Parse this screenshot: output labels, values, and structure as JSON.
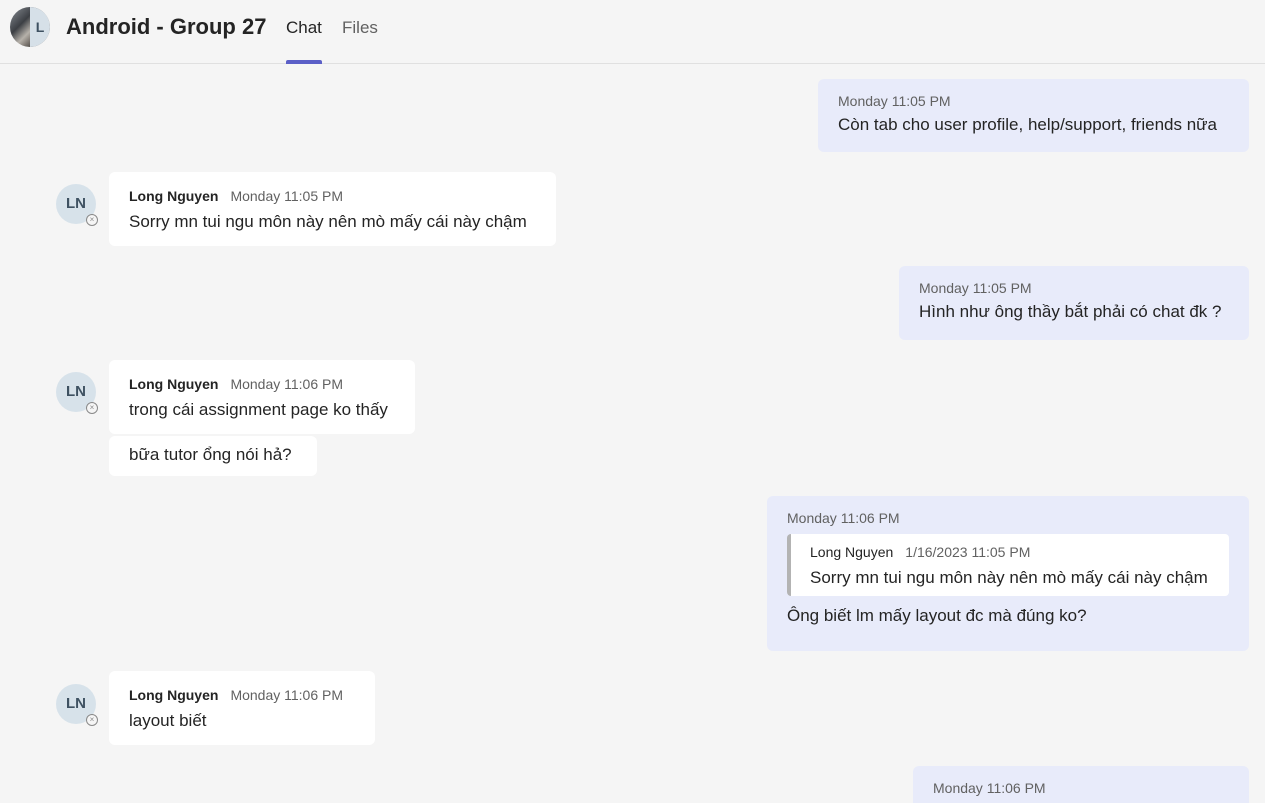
{
  "header": {
    "avatar_letter": "L",
    "title": "Android - Group 27",
    "tabs": [
      {
        "label": "Chat",
        "active": true
      },
      {
        "label": "Files",
        "active": false
      }
    ],
    "accent_color": "#5b5fc7"
  },
  "messages": [
    {
      "mine": true,
      "time": "Monday 11:05 PM",
      "text": "Còn tab cho user profile, help/support, friends nữa"
    },
    {
      "mine": false,
      "sender": "Long Nguyen",
      "initials": "LN",
      "time": "Monday 11:05 PM",
      "text": "Sorry mn tui ngu môn này nên mò mấy cái này chậm"
    },
    {
      "mine": true,
      "time": "Monday 11:05 PM",
      "text": "Hình như ông thầy bắt phải có chat đk ?"
    },
    {
      "mine": false,
      "sender": "Long Nguyen",
      "initials": "LN",
      "time": "Monday 11:06 PM",
      "text": "trong cái assignment page ko thấy"
    },
    {
      "mine": false,
      "continuation": true,
      "text": "bữa tutor ổng nói hả?"
    },
    {
      "mine": true,
      "time": "Monday 11:06 PM",
      "quote": {
        "sender": "Long Nguyen",
        "time": "1/16/2023 11:05 PM",
        "text": "Sorry mn tui ngu môn này nên mò mấy cái này chậm"
      },
      "text": "Ông biết lm mấy layout đc mà đúng ko?"
    },
    {
      "mine": false,
      "sender": "Long Nguyen",
      "initials": "LN",
      "time": "Monday 11:06 PM",
      "text": "layout biết"
    },
    {
      "mine": true,
      "time": "Monday 11:06 PM",
      "text": ""
    }
  ]
}
